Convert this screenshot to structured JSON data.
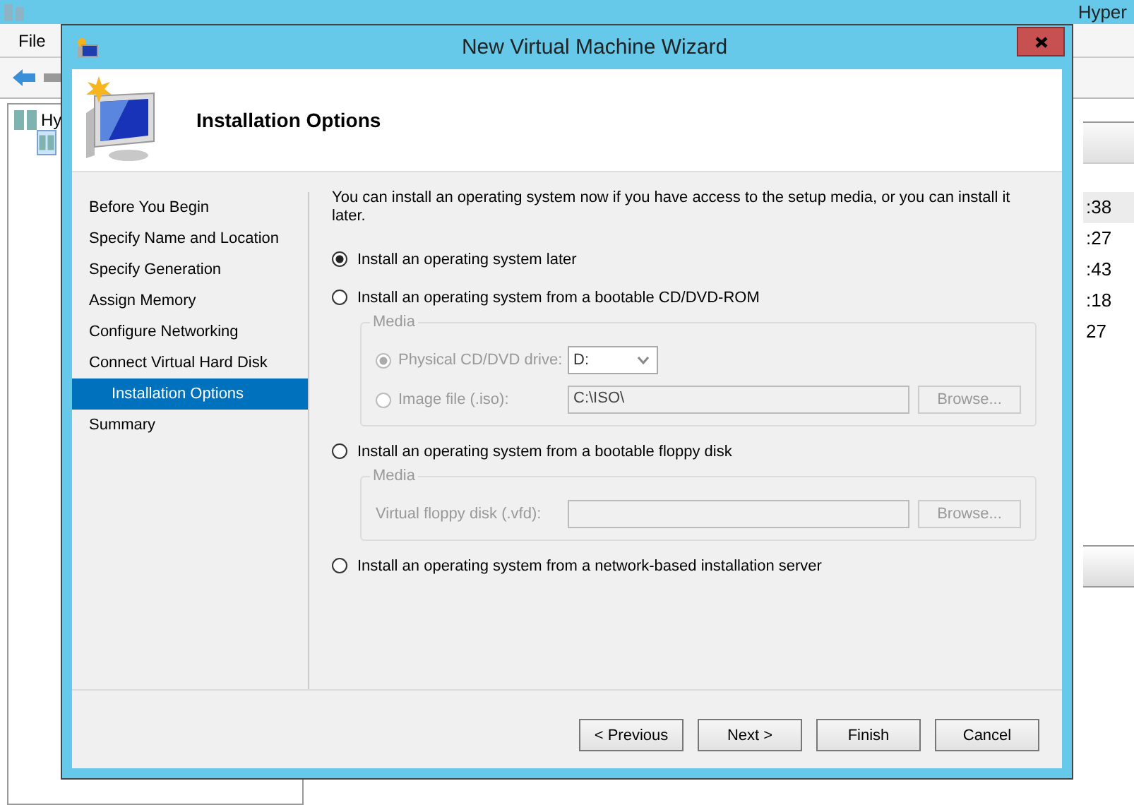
{
  "background_app": {
    "title": "Hyper",
    "menu": [
      "File"
    ],
    "tree": [
      {
        "label": "Hy",
        "children": [
          {
            "selected": true
          }
        ]
      }
    ],
    "times": [
      {
        "text": ":38",
        "selected": true
      },
      {
        "text": ":27",
        "selected": false
      },
      {
        "text": ":43",
        "selected": false
      },
      {
        "text": ":18",
        "selected": false
      },
      {
        "text": "27",
        "selected": false
      }
    ]
  },
  "wizard": {
    "title": "New Virtual Machine Wizard",
    "page_title": "Installation Options",
    "steps": [
      {
        "label": "Before You Begin",
        "selected": false
      },
      {
        "label": "Specify Name and Location",
        "selected": false
      },
      {
        "label": "Specify Generation",
        "selected": false
      },
      {
        "label": "Assign Memory",
        "selected": false
      },
      {
        "label": "Configure Networking",
        "selected": false
      },
      {
        "label": "Connect Virtual Hard Disk",
        "selected": false
      },
      {
        "label": "Installation Options",
        "selected": true
      },
      {
        "label": "Summary",
        "selected": false
      }
    ],
    "intro": "You can install an operating system now if you have access to the setup media, or you can install it later.",
    "options": [
      {
        "label": "Install an operating system later",
        "selected": true
      },
      {
        "label": "Install an operating system from a bootable CD/DVD-ROM",
        "selected": false,
        "media": {
          "title": "Media",
          "disabled": true,
          "rows": [
            {
              "kind": "radio",
              "label": "Physical CD/DVD drive:",
              "selected": true,
              "field": {
                "kind": "select",
                "value": "D:"
              }
            },
            {
              "kind": "radio",
              "label": "Image file (.iso):",
              "selected": false,
              "field": {
                "kind": "text",
                "value": "C:\\ISO\\"
              },
              "button": "Browse..."
            }
          ]
        }
      },
      {
        "label": "Install an operating system from a bootable floppy disk",
        "selected": false,
        "media": {
          "title": "Media",
          "disabled": true,
          "rows": [
            {
              "kind": "label",
              "label": "Virtual floppy disk (.vfd):",
              "field": {
                "kind": "text"
              },
              "button": "Browse..."
            }
          ]
        }
      },
      {
        "label": "Install an operating system from a network-based installation server",
        "selected": false
      }
    ],
    "buttons": [
      {
        "label": "< Previous"
      },
      {
        "label": "Next >"
      },
      {
        "label": "Finish"
      },
      {
        "label": "Cancel"
      }
    ]
  }
}
